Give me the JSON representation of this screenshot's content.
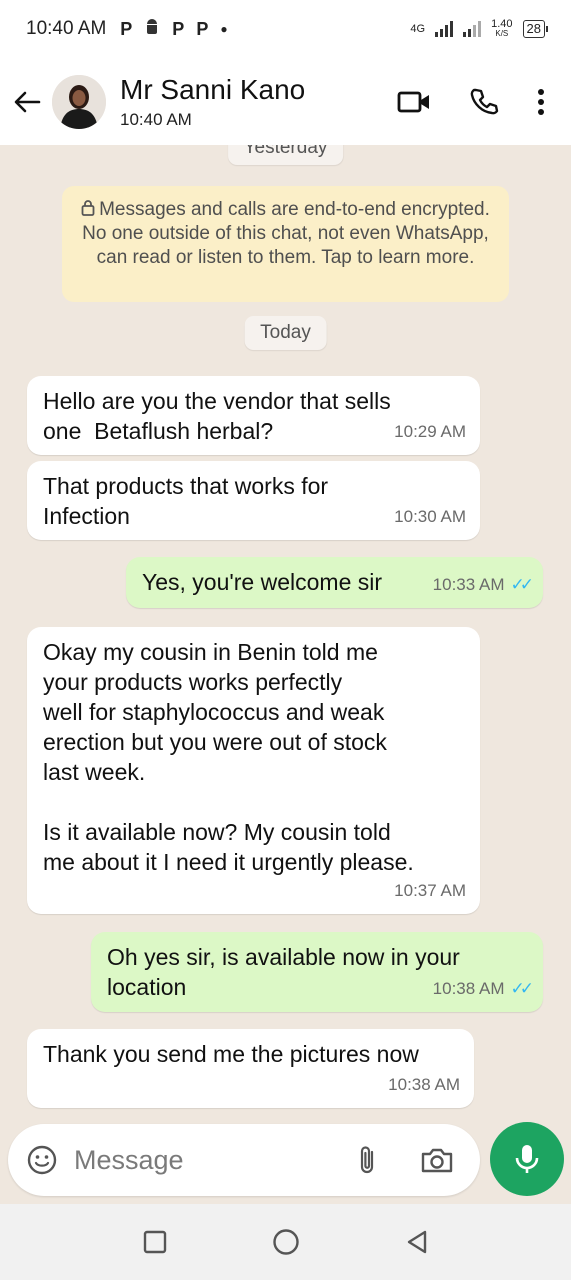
{
  "status_bar": {
    "time": "10:40 AM",
    "notification_icons": [
      "P",
      "android",
      "P",
      "P"
    ],
    "network": "4G",
    "speed": "1.40",
    "speed_unit": "K/S",
    "battery": "28"
  },
  "header": {
    "contact_name": "Mr Sanni Kano",
    "subtitle": "10:40 AM"
  },
  "chat": {
    "date_yesterday": "Yesterday",
    "encryption_notice": "Messages and calls are end-to-end encrypted. No one outside of this chat, not even WhatsApp, can read or listen to them. Tap to learn more.",
    "date_today": "Today",
    "messages": [
      {
        "direction": "incoming",
        "text": "Hello are you the vendor that sells\none  Betaflush herbal?",
        "time": "10:29 AM"
      },
      {
        "direction": "incoming",
        "text": "That products that works for\nInfection",
        "time": "10:30 AM"
      },
      {
        "direction": "outgoing",
        "text": "Yes, you're welcome sir",
        "time": "10:33 AM",
        "status": "read"
      },
      {
        "direction": "incoming",
        "text": "Okay my cousin in Benin told me\nyour products works perfectly\nwell for staphylococcus and weak\nerection but you were out of stock\nlast week.\n\nIs it available now? My cousin told\nme about it I need it urgently please.",
        "time": "10:37 AM"
      },
      {
        "direction": "outgoing",
        "text": "Oh yes sir, is available now in your\nlocation",
        "time": "10:38 AM",
        "status": "read"
      },
      {
        "direction": "incoming",
        "text": "Thank you send me the pictures now",
        "time": "10:38 AM"
      }
    ]
  },
  "composer": {
    "placeholder": "Message"
  },
  "colors": {
    "accent": "#1da461",
    "outgoing_bubble": "#dcf8c6",
    "encryption_bg": "#fbefc8",
    "read_ticks": "#34b7f1"
  }
}
